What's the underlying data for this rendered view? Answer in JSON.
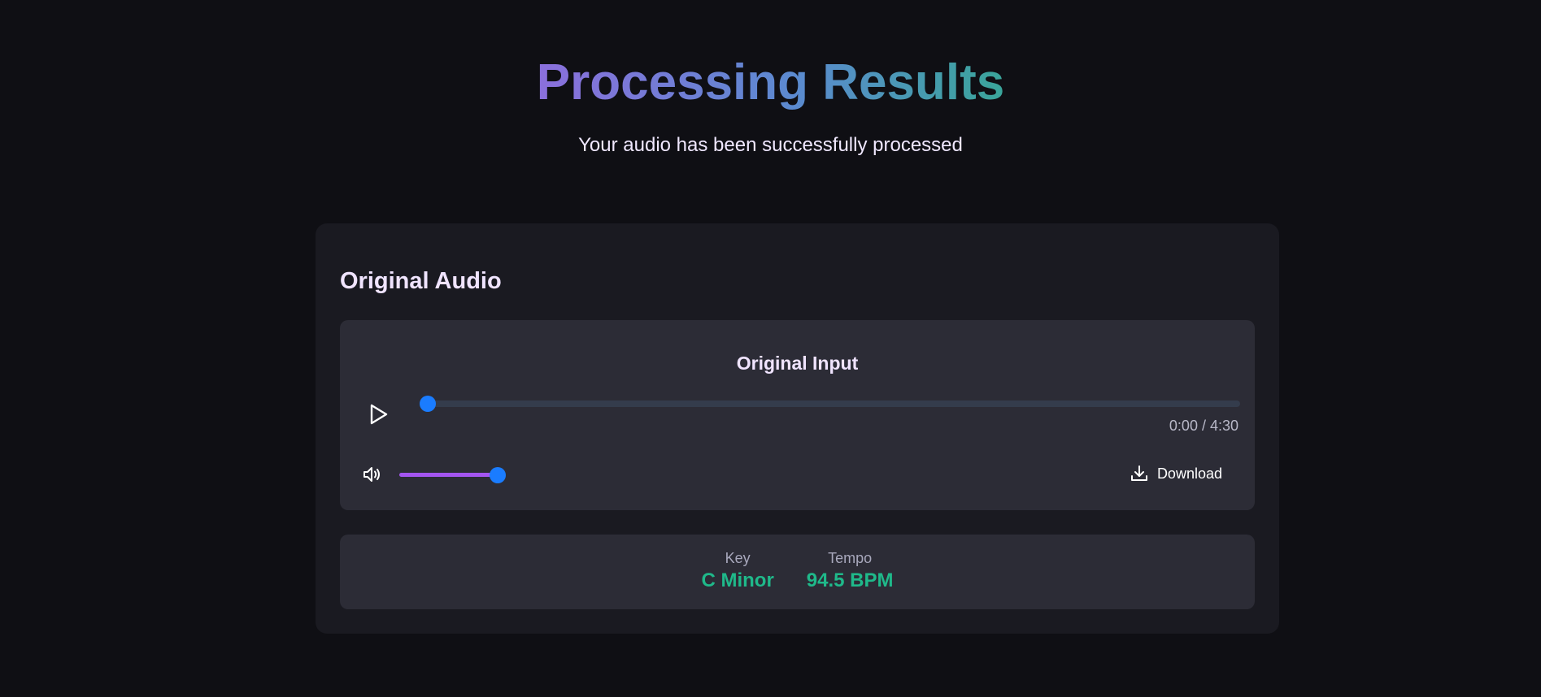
{
  "header": {
    "title": "Processing Results",
    "subtitle": "Your audio has been successfully processed"
  },
  "section": {
    "title": "Original Audio"
  },
  "player": {
    "title": "Original Input",
    "play_icon": "play-icon",
    "progress_fraction": 0.0,
    "time_display": "0:00 / 4:30",
    "volume_icon": "volume-icon",
    "volume_fraction": 0.96,
    "download_icon": "download-icon",
    "download_label": "Download",
    "accent_color": "#1a7cff",
    "volume_color": "#a455f0"
  },
  "analysis": {
    "key": {
      "label": "Key",
      "value": "C Minor"
    },
    "tempo": {
      "label": "Tempo",
      "value": "94.5 BPM"
    },
    "value_color": "#1fb98a"
  }
}
